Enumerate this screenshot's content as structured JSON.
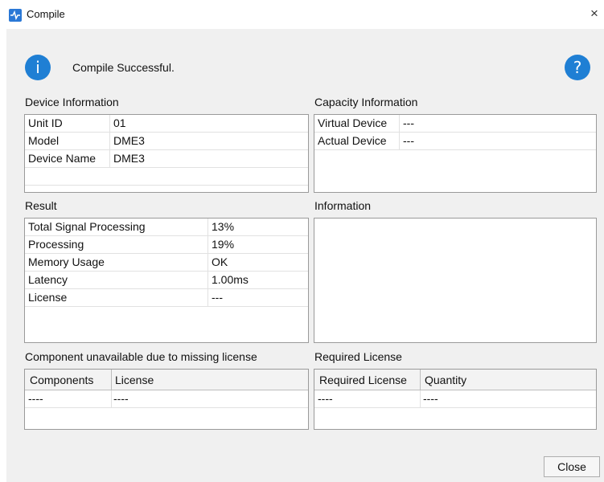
{
  "window": {
    "title": "Compile",
    "close_glyph": "×"
  },
  "message": {
    "text": "Compile Successful.",
    "info_glyph": "i",
    "help_glyph": "?"
  },
  "device_info": {
    "heading": "Device Information",
    "rows": [
      {
        "key": "Unit ID",
        "value": "01"
      },
      {
        "key": "Model",
        "value": "DME3"
      },
      {
        "key": "Device Name",
        "value": "DME3"
      }
    ]
  },
  "capacity_info": {
    "heading": "Capacity Information",
    "rows": [
      {
        "key": "Virtual Device",
        "value": "---"
      },
      {
        "key": "Actual Device",
        "value": "---"
      }
    ]
  },
  "result": {
    "heading": "Result",
    "rows": [
      {
        "key": "Total Signal Processing",
        "value": "13%"
      },
      {
        "key": "Processing",
        "value": "19%"
      },
      {
        "key": "Memory Usage",
        "value": "OK"
      },
      {
        "key": "Latency",
        "value": "1.00ms"
      },
      {
        "key": "License",
        "value": "---"
      }
    ]
  },
  "information": {
    "heading": "Information"
  },
  "unavailable": {
    "heading": "Component unavailable due to missing license",
    "columns": [
      "Components",
      "License"
    ],
    "rows": [
      [
        "----",
        "----"
      ]
    ]
  },
  "required_license": {
    "heading": "Required License",
    "columns": [
      "Required License",
      "Quantity"
    ],
    "rows": [
      [
        "----",
        "----"
      ]
    ]
  },
  "buttons": {
    "close": "Close"
  },
  "colors": {
    "accent": "#1f7fd4",
    "app_icon": "#2a78d6"
  }
}
